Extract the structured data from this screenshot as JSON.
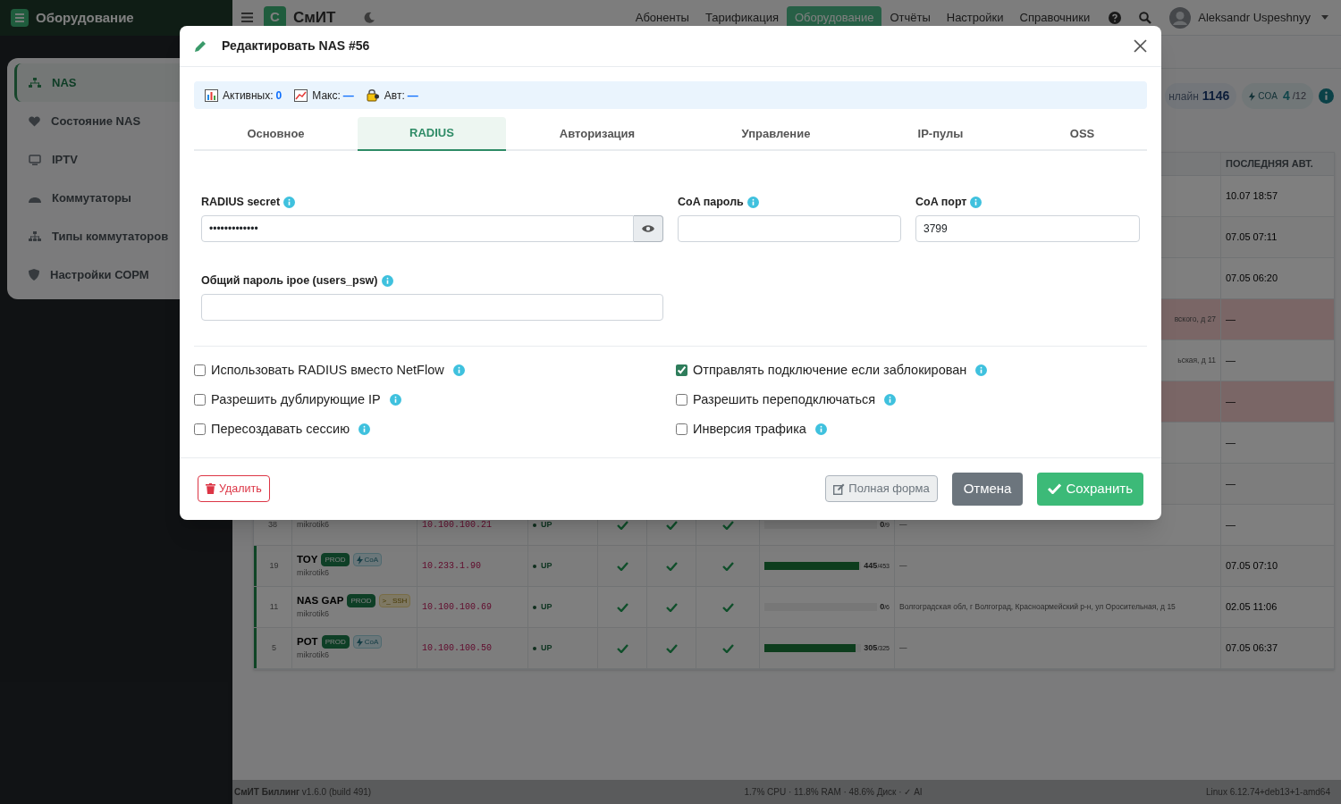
{
  "app": {
    "section_title": "Оборудование",
    "logo_letter": "С",
    "brand": "СмИТ"
  },
  "nav": [
    {
      "label": "Абоненты",
      "selected": false
    },
    {
      "label": "Тарификация",
      "selected": false
    },
    {
      "label": "Оборудование",
      "selected": true
    },
    {
      "label": "Отчёты",
      "selected": false
    },
    {
      "label": "Настройки",
      "selected": false
    },
    {
      "label": "Справочники",
      "selected": false
    }
  ],
  "user": {
    "name": "Aleksandr Uspeshnyy"
  },
  "sidebar": {
    "items": [
      {
        "label": "NAS",
        "kind": "network",
        "selected": true
      },
      {
        "label": "Состояние NAS",
        "kind": "heart",
        "selected": false
      },
      {
        "label": "IPTV",
        "kind": "monitor",
        "selected": false
      },
      {
        "label": "Коммутаторы",
        "kind": "dome",
        "selected": false
      },
      {
        "label": "Типы коммутаторов",
        "kind": "tree",
        "selected": false
      },
      {
        "label": "Настройки СОРМ",
        "kind": "shield",
        "selected": false
      }
    ]
  },
  "stats": {
    "online_label": "нлайн",
    "online_value": "1146",
    "coa_label": "COA",
    "coa_value": "4",
    "coa_total": "/12"
  },
  "table": {
    "last_auth_header": "ПОСЛЕДНЯЯ АВТ.",
    "rows": [
      {
        "last_auth": "10.07 18:57",
        "alert": false
      },
      {
        "last_auth": "07.05 07:11",
        "alert": false
      },
      {
        "last_auth": "07.05 06:20",
        "alert": false
      },
      {
        "address": "вского, д 27",
        "last_auth": "—",
        "alert": true
      },
      {
        "address": "ьская, д 11",
        "last_auth": "—",
        "alert": false
      },
      {
        "last_auth": "—",
        "alert": true
      },
      {
        "last_auth": "—",
        "alert": false
      },
      {
        "last_auth": "—",
        "alert": false
      },
      {
        "id": "38",
        "model": "mikrotik6",
        "ip": "10.100.100.21",
        "status": "UP",
        "checks": [
          true,
          true,
          true
        ],
        "sessions": "0",
        "limit": "/9",
        "level": 0,
        "address": "—",
        "last_auth": "—",
        "alert": false,
        "highlighted": false
      },
      {
        "id": "19",
        "name": "TOY",
        "tags": [
          {
            "label": "PROD",
            "kind": "prod"
          },
          {
            "label": "CoA",
            "kind": "coa"
          }
        ],
        "model": "mikrotik6",
        "ip": "10.233.1.90",
        "status": "UP",
        "checks": [
          true,
          true,
          true
        ],
        "sessions": "445",
        "limit": "/453",
        "level": 0.98,
        "address": "—",
        "last_auth": "07.05 07:10",
        "alert": false,
        "highlighted": true
      },
      {
        "id": "11",
        "name": "NAS GAP",
        "tags": [
          {
            "label": "PROD",
            "kind": "prod"
          },
          {
            "label": ">_ SSH",
            "kind": "ssh"
          }
        ],
        "model": "mikrotik6",
        "ip": "10.100.100.69",
        "status": "UP",
        "checks": [
          true,
          true,
          true
        ],
        "sessions": "0",
        "limit": "/6",
        "level": 0,
        "address": "Волгоградская обл, г Волгоград, Красноармейский р-н, ул Оросительная, д 15",
        "last_auth": "02.05 11:06",
        "alert": false,
        "highlighted": true
      },
      {
        "id": "5",
        "name": "POT",
        "tags": [
          {
            "label": "PROD",
            "kind": "prod"
          },
          {
            "label": "CoA",
            "kind": "coa"
          }
        ],
        "model": "mikrotik6",
        "ip": "10.100.100.50",
        "status": "UP",
        "checks": [
          true,
          true,
          true
        ],
        "sessions": "305",
        "limit": "/325",
        "level": 0.94,
        "address": "—",
        "last_auth": "07.05 06:37",
        "alert": false,
        "highlighted": true
      }
    ]
  },
  "status_bar": {
    "app": "СмИТ Биллинг",
    "version": "v1.6.0 (build 491)",
    "metrics": "1.7% CPU · 11.8% RAM · 48.6% Диск · ✓ AI",
    "os": "Linux 6.12.74+deb13+1-amd64"
  },
  "modal": {
    "title": "Редактировать NAS #56",
    "info": [
      {
        "kind": "chart",
        "label": "Активных:",
        "value": "0"
      },
      {
        "kind": "trend",
        "label": "Макс:",
        "value": "—"
      },
      {
        "kind": "key",
        "label": "Авт:",
        "value": "—"
      }
    ],
    "tabs": [
      {
        "label": "Основное",
        "selected": false
      },
      {
        "label": "RADIUS",
        "selected": true
      },
      {
        "label": "Авторизация",
        "selected": false
      },
      {
        "label": "Управление",
        "selected": false
      },
      {
        "label": "IP-пулы",
        "selected": false
      },
      {
        "label": "OSS",
        "selected": false
      }
    ],
    "fields": [
      {
        "label": "RADIUS secret",
        "kind": "password",
        "value": "•••••••••••••"
      },
      {
        "label": "CoA пароль",
        "kind": "text"
      },
      {
        "label": "CoA порт",
        "kind": "text",
        "value": "3799"
      },
      {
        "label": "Общий пароль ipoe (users_psw)",
        "kind": "text"
      }
    ],
    "checkbox_columns": [
      [
        {
          "label": "Использовать RADIUS вместо NetFlow",
          "checked": false
        },
        {
          "label": "Разрешить дублирующие IP",
          "checked": false
        },
        {
          "label": "Пересоздавать сессию",
          "checked": false
        }
      ],
      [
        {
          "label": "Отправлять подключение если заблокирован",
          "checked": true
        },
        {
          "label": "Разрешить переподключаться",
          "checked": false
        },
        {
          "label": "Инверсия трафика",
          "checked": false
        }
      ]
    ],
    "buttons": [
      {
        "label": "Удалить",
        "kind": "danger"
      },
      {
        "label": "Полная форма",
        "kind": "secondary"
      },
      {
        "label": "Отмена",
        "kind": "cancel"
      },
      {
        "label": "Сохранить",
        "kind": "primary"
      }
    ]
  }
}
